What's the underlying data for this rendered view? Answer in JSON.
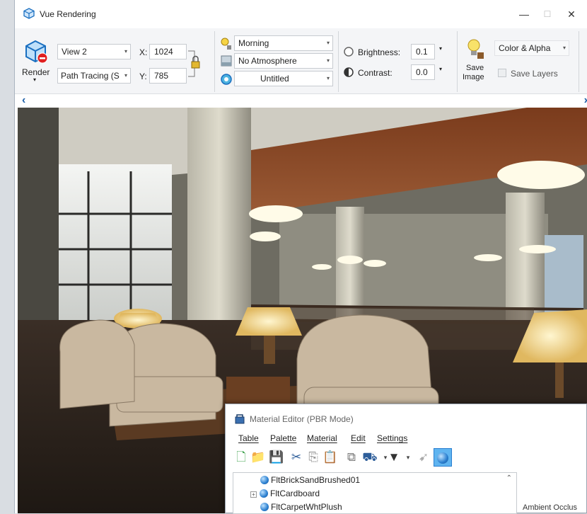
{
  "window": {
    "title": "Vue Rendering",
    "minimize": "—",
    "maximize": "☐",
    "close": "✕"
  },
  "toolbar": {
    "render_label": "Render",
    "view": "View 2",
    "renderer": "Path Tracing (S",
    "x_label": "X:",
    "x_value": "1024",
    "y_label": "Y:",
    "y_value": "785",
    "time_of_day": "Morning",
    "atmosphere": "No Atmosphere",
    "scene_name": "Untitled",
    "brightness_label": "Brightness:",
    "brightness_value": "0.1",
    "contrast_label": "Contrast:",
    "contrast_value": "0.0",
    "save_image_label": "Save Image",
    "output_mode": "Color & Alpha",
    "save_layers_label": "Save Layers",
    "save_layers_checked": false
  },
  "nav": {
    "left": "‹",
    "right": "›"
  },
  "material_editor": {
    "title": "Material Editor (PBR Mode)",
    "menu": [
      "Table",
      "Palette",
      "Material",
      "Edit",
      "Settings"
    ],
    "tree_items": [
      {
        "label": "FltBrickSandBrushed01",
        "expandable": false
      },
      {
        "label": "FltCardboard",
        "expandable": true
      },
      {
        "label": "FltCarpetWhtPlush",
        "expandable": false
      }
    ],
    "side_text": "Ambient Occlus"
  },
  "colors": {
    "accent": "#1a5ea8",
    "toolbar_bg": "#f4f5f7"
  }
}
